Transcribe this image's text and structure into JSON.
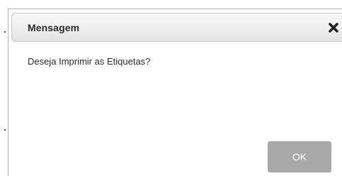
{
  "dialog": {
    "title": "Mensagem",
    "message": "Deseja Imprimir as Etiquetas?",
    "ok_label": "OK",
    "close_icon": "close-icon"
  },
  "colors": {
    "titlebar_top": "#f8f8f8",
    "titlebar_bottom": "#e3e3e3",
    "button_bg": "#a9a9a9",
    "button_text": "#ffffff",
    "text": "#2b2b2b"
  }
}
